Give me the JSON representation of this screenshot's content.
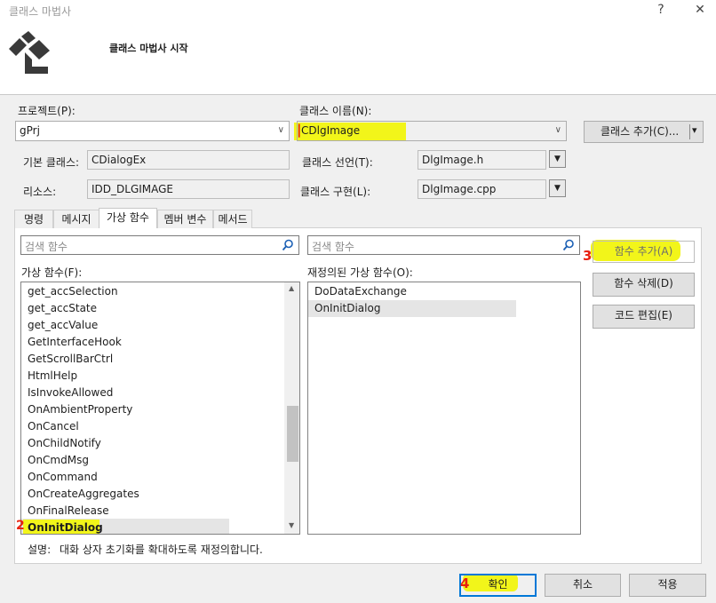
{
  "window": {
    "title": "클래스 마법사",
    "help_glyph": "?",
    "close_glyph": "✕",
    "heading": "클래스 마법사 시작"
  },
  "project": {
    "label": "프로젝트(P):",
    "value": "gPrj"
  },
  "class_name": {
    "label": "클래스 이름(N):",
    "value": "CDlgImage"
  },
  "add_class_button": {
    "label": "클래스 추가(C)...",
    "dropdown_glyph": "▾"
  },
  "base_class": {
    "label": "기본 클래스:",
    "value": "CDialogEx"
  },
  "resource": {
    "label": "리소스:",
    "value": "IDD_DLGIMAGE"
  },
  "class_declaration": {
    "label": "클래스 선언(T):",
    "value": "DlgImage.h"
  },
  "class_implementation": {
    "label": "클래스 구현(L):",
    "value": "DlgImage.cpp"
  },
  "tabs": [
    {
      "label": "명령"
    },
    {
      "label": "메시지"
    },
    {
      "label": "가상 함수"
    },
    {
      "label": "멤버 변수"
    },
    {
      "label": "메서드"
    }
  ],
  "left_search": {
    "placeholder": "검색 함수"
  },
  "right_search": {
    "placeholder": "검색 함수"
  },
  "virtual_functions": {
    "label": "가상 함수(F):",
    "items": [
      "get_accSelection",
      "get_accState",
      "get_accValue",
      "GetInterfaceHook",
      "GetScrollBarCtrl",
      "HtmlHelp",
      "IsInvokeAllowed",
      "OnAmbientProperty",
      "OnCancel",
      "OnChildNotify",
      "OnCmdMsg",
      "OnCommand",
      "OnCreateAggregates",
      "OnFinalRelease",
      "OnInitDialog"
    ],
    "selected": "OnInitDialog",
    "scroll_up_glyph": "▲",
    "scroll_down_glyph": "▼"
  },
  "overridden_functions": {
    "label": "재정의된 가상 함수(O):",
    "items": [
      "DoDataExchange",
      "OnInitDialog"
    ]
  },
  "side_buttons": {
    "add_function": "함수 추가(A)",
    "delete_function": "함수 삭제(D)",
    "edit_code": "코드 편집(E)"
  },
  "description": {
    "label": "설명:",
    "text": "대화 상자 초기화를 확대하도록 재정의합니다."
  },
  "footer_buttons": {
    "ok": "확인",
    "cancel": "취소",
    "apply": "적용"
  },
  "annotations": {
    "mark_1": "|",
    "mark_2": "2",
    "mark_3": "3",
    "mark_4": "4"
  },
  "colors": {
    "highlighter": "#f2f51a",
    "annotation_red": "#e8210f",
    "accent": "#0078d7"
  }
}
